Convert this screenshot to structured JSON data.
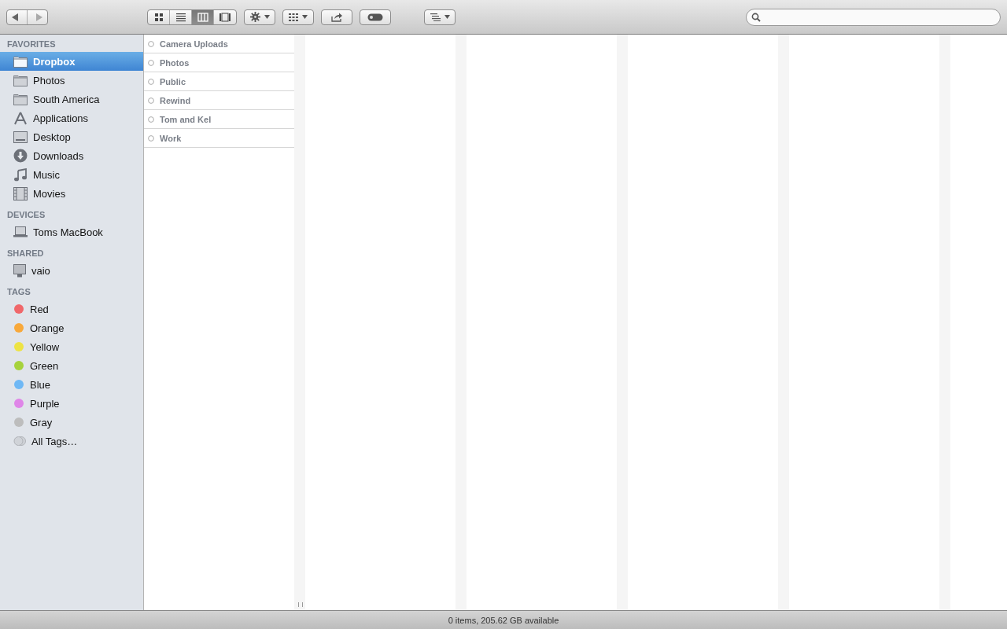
{
  "toolbar": {
    "view_buttons": [
      {
        "kind": "icons",
        "selected": false
      },
      {
        "kind": "list",
        "selected": false
      },
      {
        "kind": "columns",
        "selected": true
      },
      {
        "kind": "coverflow",
        "selected": false
      }
    ]
  },
  "sidebar": {
    "sections": [
      {
        "title": "FAVORITES",
        "items": [
          {
            "label": "Dropbox",
            "kind": "folder",
            "selected": true
          },
          {
            "label": "Photos",
            "kind": "folder",
            "selected": false
          },
          {
            "label": "South America",
            "kind": "folder",
            "selected": false
          },
          {
            "label": "Applications",
            "kind": "apps",
            "selected": false
          },
          {
            "label": "Desktop",
            "kind": "desktop",
            "selected": false
          },
          {
            "label": "Downloads",
            "kind": "download",
            "selected": false
          },
          {
            "label": "Music",
            "kind": "music",
            "selected": false
          },
          {
            "label": "Movies",
            "kind": "movies",
            "selected": false
          }
        ]
      },
      {
        "title": "DEVICES",
        "items": [
          {
            "label": "Toms MacBook",
            "kind": "laptop",
            "selected": false
          }
        ]
      },
      {
        "title": "SHARED",
        "items": [
          {
            "label": "vaio",
            "kind": "monitor",
            "selected": false
          }
        ]
      },
      {
        "title": "TAGS",
        "items": [
          {
            "label": "Red",
            "kind": "tag",
            "color": "#f0676a",
            "selected": false
          },
          {
            "label": "Orange",
            "kind": "tag",
            "color": "#f8a83a",
            "selected": false
          },
          {
            "label": "Yellow",
            "kind": "tag",
            "color": "#ede344",
            "selected": false
          },
          {
            "label": "Green",
            "kind": "tag",
            "color": "#a6d23c",
            "selected": false
          },
          {
            "label": "Blue",
            "kind": "tag",
            "color": "#6fb8f5",
            "selected": false
          },
          {
            "label": "Purple",
            "kind": "tag",
            "color": "#df86e8",
            "selected": false
          },
          {
            "label": "Gray",
            "kind": "tag",
            "color": "#bdbdbd",
            "selected": false
          },
          {
            "label": "All Tags…",
            "kind": "alltags",
            "selected": false
          }
        ]
      }
    ]
  },
  "column_1": {
    "items": [
      "Camera Uploads",
      "Photos",
      "Public",
      "Rewind",
      "Tom and Kel",
      "Work"
    ]
  },
  "status_bar": "0 items, 205.62 GB available"
}
